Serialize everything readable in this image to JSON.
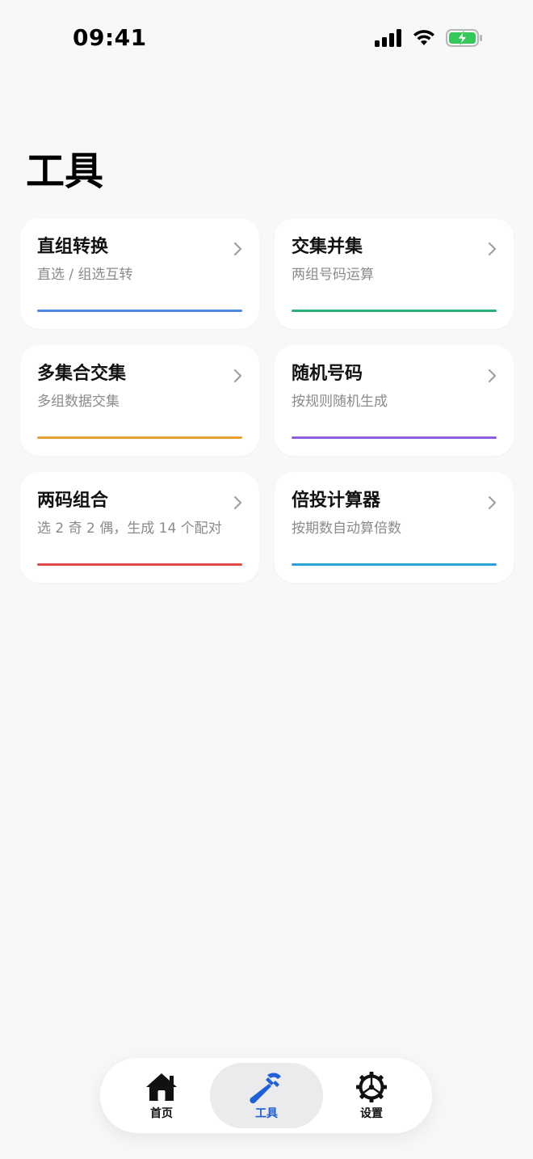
{
  "status": {
    "time": "09:41"
  },
  "page": {
    "title": "工具"
  },
  "tools": [
    {
      "title": "直组转换",
      "desc": "直选 / 组选互转",
      "accent": "#4a86e4"
    },
    {
      "title": "交集并集",
      "desc": "两组号码运算",
      "accent": "#2bb07a"
    },
    {
      "title": "多集合交集",
      "desc": "多组数据交集",
      "accent": "#e8a032"
    },
    {
      "title": "随机号码",
      "desc": "按规则随机生成",
      "accent": "#8a5fe0"
    },
    {
      "title": "两码组合",
      "desc": "选 2 奇 2 偶，生成 14 个配对",
      "accent": "#db4d45"
    },
    {
      "title": "倍投计算器",
      "desc": "按期数自动算倍数",
      "accent": "#2aa3dc"
    }
  ],
  "tabbar": {
    "items": [
      {
        "label": "首页",
        "icon": "house-icon",
        "active": false
      },
      {
        "label": "工具",
        "icon": "hammer-icon",
        "active": true
      },
      {
        "label": "设置",
        "icon": "gear-icon",
        "active": false
      }
    ]
  },
  "colors": {
    "background": "#f7f8fa",
    "active_tab": "#1f5fd8",
    "battery": "#34c759"
  }
}
